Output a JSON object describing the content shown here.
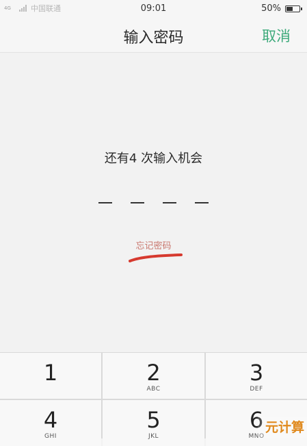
{
  "status_bar": {
    "network": "4G",
    "carrier": "中国联通",
    "time": "09:01",
    "battery_percent": "50%",
    "battery_level": 0.5
  },
  "nav": {
    "title": "输入密码",
    "cancel_label": "取消"
  },
  "main": {
    "attempts_text": "还有4 次输入机会",
    "pin_length": 4,
    "forgot_label": "忘记密码"
  },
  "keypad": {
    "keys": [
      {
        "digit": "1",
        "letters": ""
      },
      {
        "digit": "2",
        "letters": "ABC"
      },
      {
        "digit": "3",
        "letters": "DEF"
      },
      {
        "digit": "4",
        "letters": "GHI"
      },
      {
        "digit": "5",
        "letters": "JKL"
      },
      {
        "digit": "6",
        "letters": "MNO"
      }
    ]
  },
  "watermark": {
    "text": "元计算"
  },
  "colors": {
    "accent": "#3daa7b",
    "forgot": "#c9786f",
    "annotation": "#d63a2f"
  }
}
